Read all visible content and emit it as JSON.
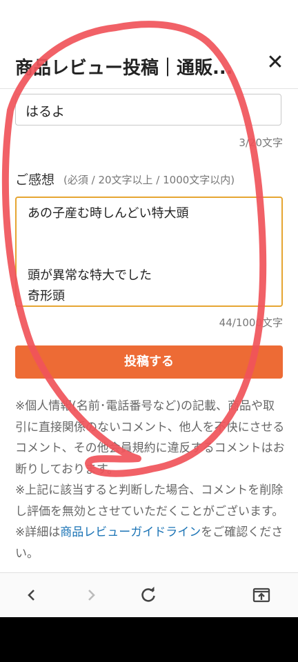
{
  "header": {
    "title": "商品レビュー投稿｜通販...",
    "close_label": "✕"
  },
  "title_field": {
    "value": "はるよ",
    "counter": "3/20文字"
  },
  "comment_field": {
    "label": "ご感想",
    "note": "(必須 / 20文字以上 / 1000文字以内)",
    "lines": [
      "あの子産む時しんどい特大頭",
      "",
      "",
      "頭が異常な特大でした",
      "奇形頭"
    ],
    "counter": "44/1000文字"
  },
  "submit": {
    "label": "投稿する",
    "color": "#ed6b35"
  },
  "notice": {
    "p1": "※個人情報(名前･電話番号など)の記載、商品や取引に直接関係のないコメント、他人を不快にさせるコメント、その他会員規約に違反するコメントはお断りしております。",
    "p2": "※上記に該当すると判断した場合、コメントを削除し評価を無効とさせていただくことがございます。",
    "p3_prefix": "※詳細は",
    "p3_link": "商品レビューガイドライン",
    "p3_suffix": "をご確認ください。"
  },
  "browser_nav": {
    "back_icon": "chevron-left-icon",
    "forward_icon": "chevron-right-icon",
    "reload_icon": "reload-icon",
    "share_icon": "share-icon"
  },
  "overlay": {
    "scribble_color": "#f0545a"
  }
}
